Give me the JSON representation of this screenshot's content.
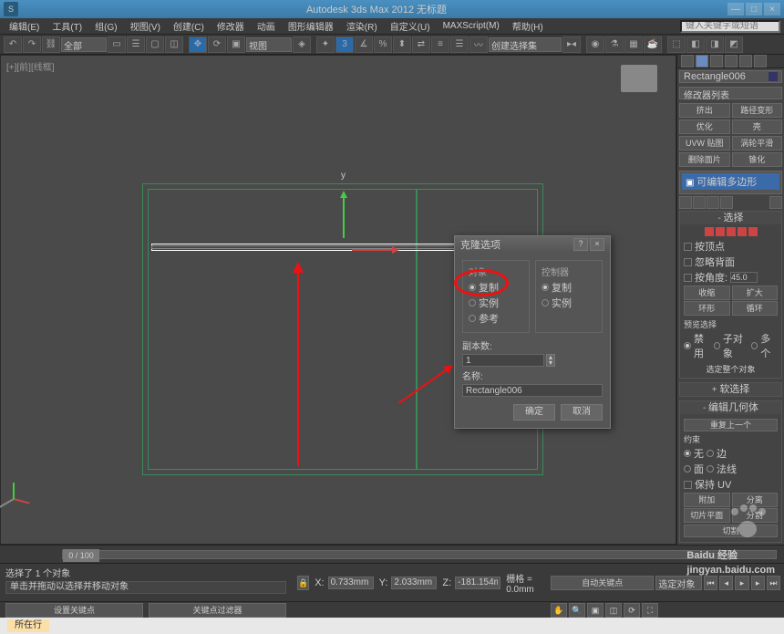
{
  "titlebar": {
    "logo": "S",
    "title": "Autodesk 3ds Max 2012         无标题",
    "min": "—",
    "max": "□",
    "close": "×"
  },
  "menu": {
    "items": [
      "编辑(E)",
      "工具(T)",
      "组(G)",
      "视图(V)",
      "创建(C)",
      "修改器",
      "动画",
      "图形编辑器",
      "渲染(R)",
      "自定义(U)",
      "MAXScript(M)",
      "帮助(H)"
    ],
    "search_ph": "键入关键字或短语"
  },
  "toolbar": {
    "selset_label": "全部",
    "createset": "创建选择集"
  },
  "viewport": {
    "label": "[+][前][线框]",
    "axis_y": "y"
  },
  "dialog": {
    "title": "克隆选项",
    "help": "?",
    "close": "×",
    "obj_legend": "对象",
    "ctrl_legend": "控制器",
    "copy": "复制",
    "instance": "实例",
    "reference": "参考",
    "copies_label": "副本数:",
    "copies": "1",
    "name_label": "名称:",
    "name": "Rectangle006",
    "ok": "确定",
    "cancel": "取消"
  },
  "panel": {
    "objname": "Rectangle006",
    "modlist": "修改器列表",
    "btns": [
      "挤出",
      "路径变形",
      "优化",
      "壳",
      "UVW 贴图",
      "涡轮平滑",
      "删除面片",
      "锥化"
    ],
    "stack": "可编辑多边形",
    "ro_select": "选择",
    "by_vertex": "按顶点",
    "ignore_bf": "忽略背面",
    "by_angle": "按角度:",
    "angle": "45.0",
    "grow": "扩大",
    "shrink": "收缩",
    "ring": "环形",
    "loop": "循环",
    "preview": "预览选择",
    "off": "禁用",
    "subobj": "子对象",
    "multi": "多个",
    "sel_whole": "选定整个对象",
    "ro_soft": "软选择",
    "ro_geo": "编辑几何体",
    "ro_repeat": "重复上一个",
    "constraints": "约束",
    "none": "无",
    "edge": "边",
    "face": "面",
    "normal": "法线",
    "preserve_uv": "保持 UV",
    "attach": "附加",
    "detach": "分离",
    "slice_plane": "切片平面",
    "slice": "分割",
    "cut": "切割"
  },
  "timeline": {
    "marker": "0 / 100"
  },
  "status": {
    "sel": "选择了 1 个对象",
    "prompt": "单击并拖动以选择并移动对象",
    "x": "0.733mm",
    "y": "2.033mm",
    "z": "-181.154mm",
    "grid": "栅格 = 0.0mm",
    "autokey": "自动关键点",
    "selset2": "选定对象",
    "setkey": "设置关键点",
    "keyfilter": "关键点过滤器"
  },
  "footer": {
    "tab": "所在行",
    "info": ""
  },
  "watermark": {
    "main": "Baidu 经验",
    "sub": "jingyan.baidu.com"
  }
}
